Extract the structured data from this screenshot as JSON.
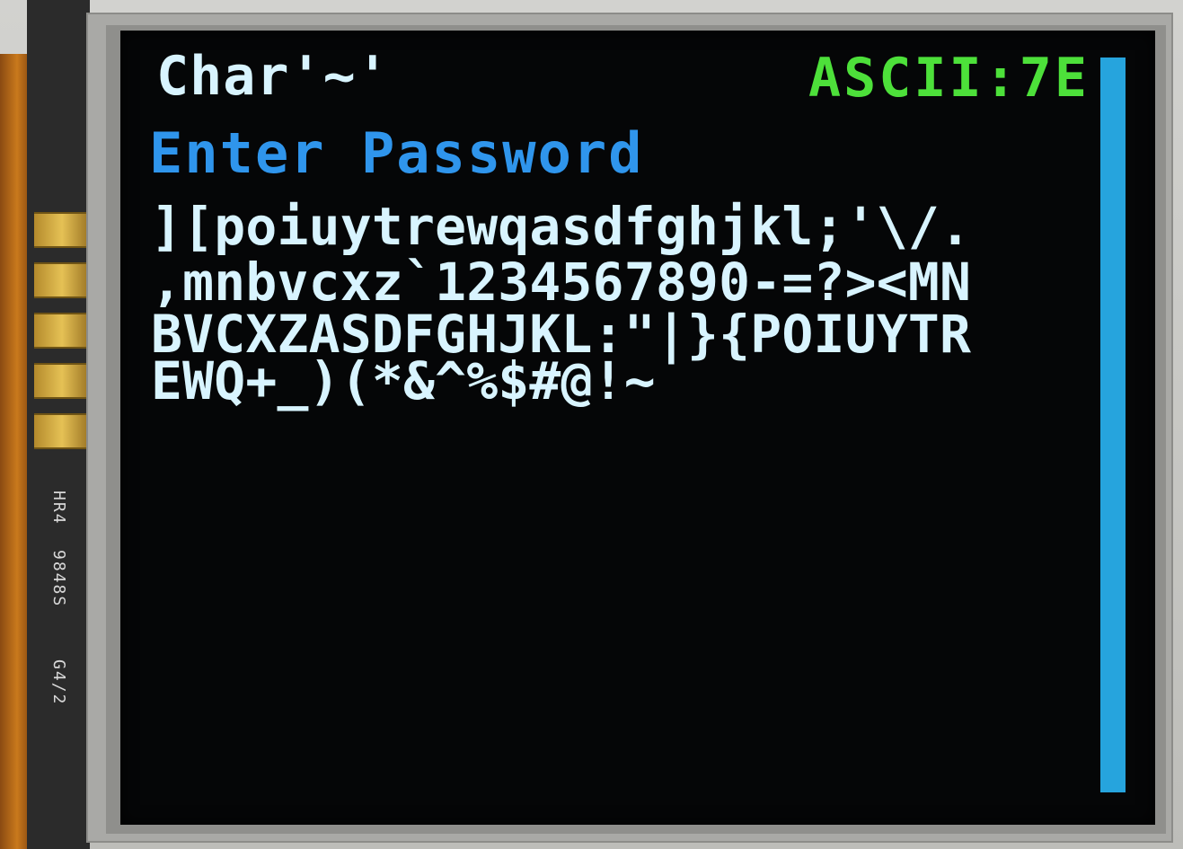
{
  "device": {
    "pcb_silkscreen": [
      "HR4",
      "9848S",
      "G4/2"
    ]
  },
  "screen": {
    "char_label": "Char'~'",
    "ascii_label": "ASCII:7E",
    "title": "Enter Password",
    "password_lines": [
      "][poiuytrewqasdfghjkl;'\\/.",
      ",mnbvcxz`1234567890-=?><MN",
      "BVCXZASDFGHJKL:\"|}{POIUYTR",
      "EWQ+_)(*&^%$#@!~"
    ],
    "scrollbar_color": "#26a4dd",
    "text_color": "#d8f4ff",
    "title_color": "#2f95ec",
    "ascii_color": "#4de03a",
    "background_color": "#050607"
  }
}
